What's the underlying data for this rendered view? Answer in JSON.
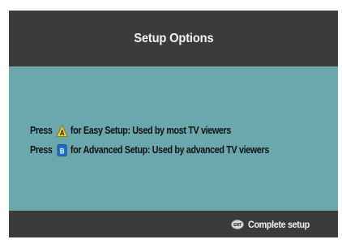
{
  "header": {
    "title": "Setup Options"
  },
  "options": [
    {
      "prefix": "Press",
      "button": "A",
      "button_icon": "yellow-triangle-a-icon",
      "button_color": "#f2d21a",
      "text": "for Easy Setup: Used by most TV viewers"
    },
    {
      "prefix": "Press",
      "button": "B",
      "button_icon": "blue-square-b-icon",
      "button_color": "#1f6fc9",
      "text": "for Advanced Setup: Used by advanced TV viewers"
    }
  ],
  "footer": {
    "exit_button": "EXIT",
    "exit_label": "Complete setup"
  },
  "colors": {
    "background": "#3a3c3b",
    "panel": "#6aa8ae",
    "title_text": "#f2f2f2",
    "body_text": "#111111"
  }
}
